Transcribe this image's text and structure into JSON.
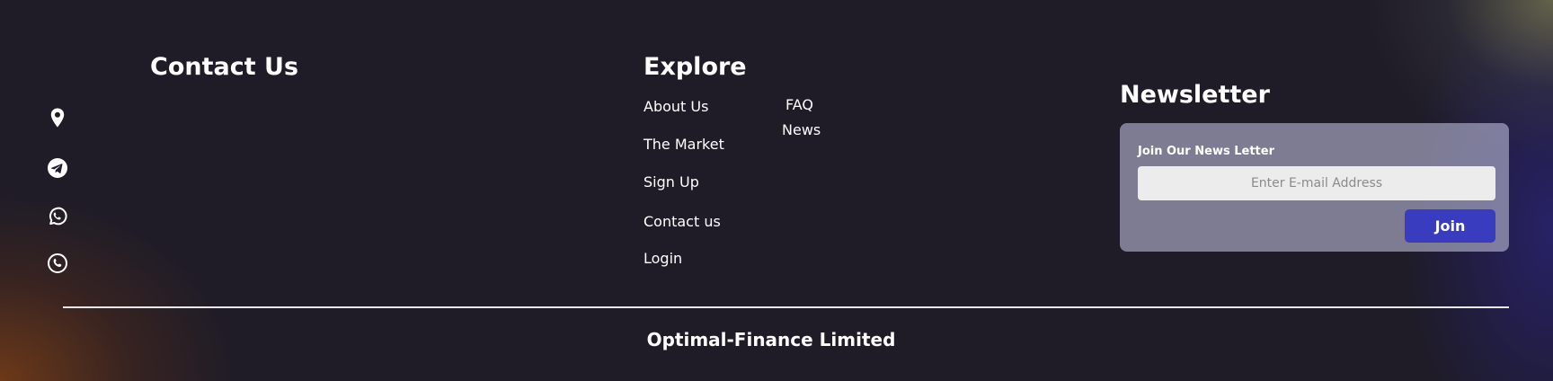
{
  "contact": {
    "title": "Contact Us",
    "icons": [
      "location-pin-icon",
      "telegram-icon",
      "whatsapp-icon",
      "phone-icon"
    ]
  },
  "explore": {
    "title": "Explore",
    "links": [
      "About Us",
      "The Market",
      "Sign Up",
      "Contact us",
      "Login",
      "FAQ",
      "News"
    ]
  },
  "newsletter": {
    "title": "Newsletter",
    "card_label": "Join Our News Letter",
    "email_placeholder": "Enter E-mail Address",
    "email_value": "",
    "join_label": "Join"
  },
  "footer": {
    "company": "Optimal-Finance Limited"
  },
  "colors": {
    "background": "#1f1c27",
    "accent_button": "#3a3cc0",
    "text": "#ffffff",
    "card": "#8a8799",
    "input_bg": "#ececec"
  }
}
